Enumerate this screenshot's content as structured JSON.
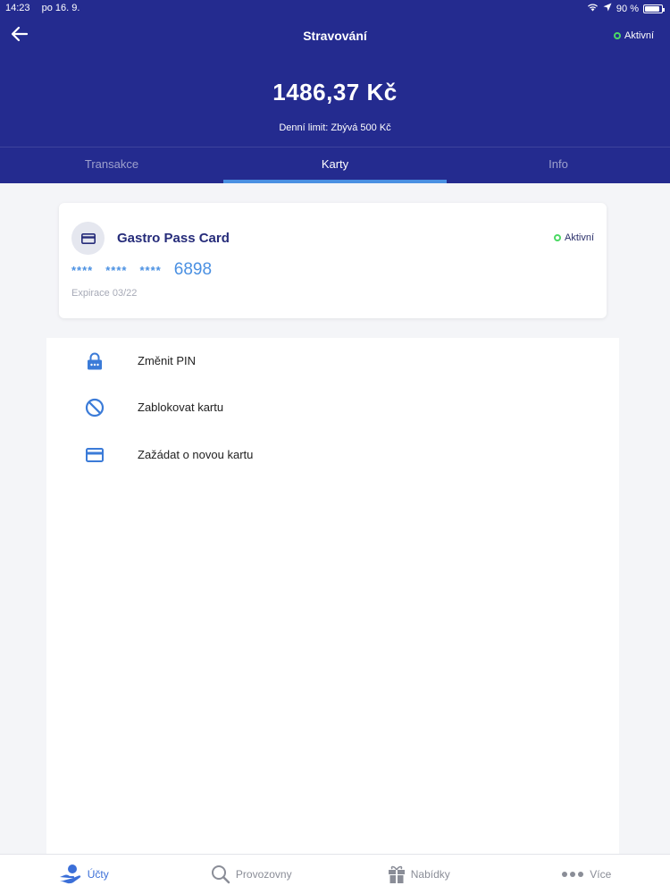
{
  "status_bar": {
    "time": "14:23",
    "date": "po 16. 9.",
    "battery": "90 %",
    "battery_level": 0.9
  },
  "header": {
    "title": "Stravování",
    "status": "Aktivní",
    "balance": "1486,37 Kč",
    "limit": "Denní limit: Zbývá 500 Kč"
  },
  "tabs": [
    {
      "label": "Transakce",
      "active": false
    },
    {
      "label": "Karty",
      "active": true
    },
    {
      "label": "Info",
      "active": false
    }
  ],
  "card": {
    "name": "Gastro Pass Card",
    "status": "Aktivní",
    "masked": [
      "****",
      "****",
      "****"
    ],
    "last4": "6898",
    "expiry": "Expirace 03/22"
  },
  "actions": [
    {
      "label": "Změnit PIN",
      "icon": "lock-icon"
    },
    {
      "label": "Zablokovat kartu",
      "icon": "block-icon"
    },
    {
      "label": "Zažádat o novou kartu",
      "icon": "credit-card-icon"
    }
  ],
  "bottom_nav": [
    {
      "label": "Účty",
      "icon": "hand-coin-icon",
      "active": true
    },
    {
      "label": "Provozovny",
      "icon": "search-icon",
      "active": false
    },
    {
      "label": "Nabídky",
      "icon": "gift-icon",
      "active": false
    },
    {
      "label": "Více",
      "icon": "more-dots-icon",
      "active": false
    }
  ],
  "colors": {
    "header_bg": "#242b8f",
    "accent": "#4a90e2",
    "active_green": "#4cd964"
  }
}
